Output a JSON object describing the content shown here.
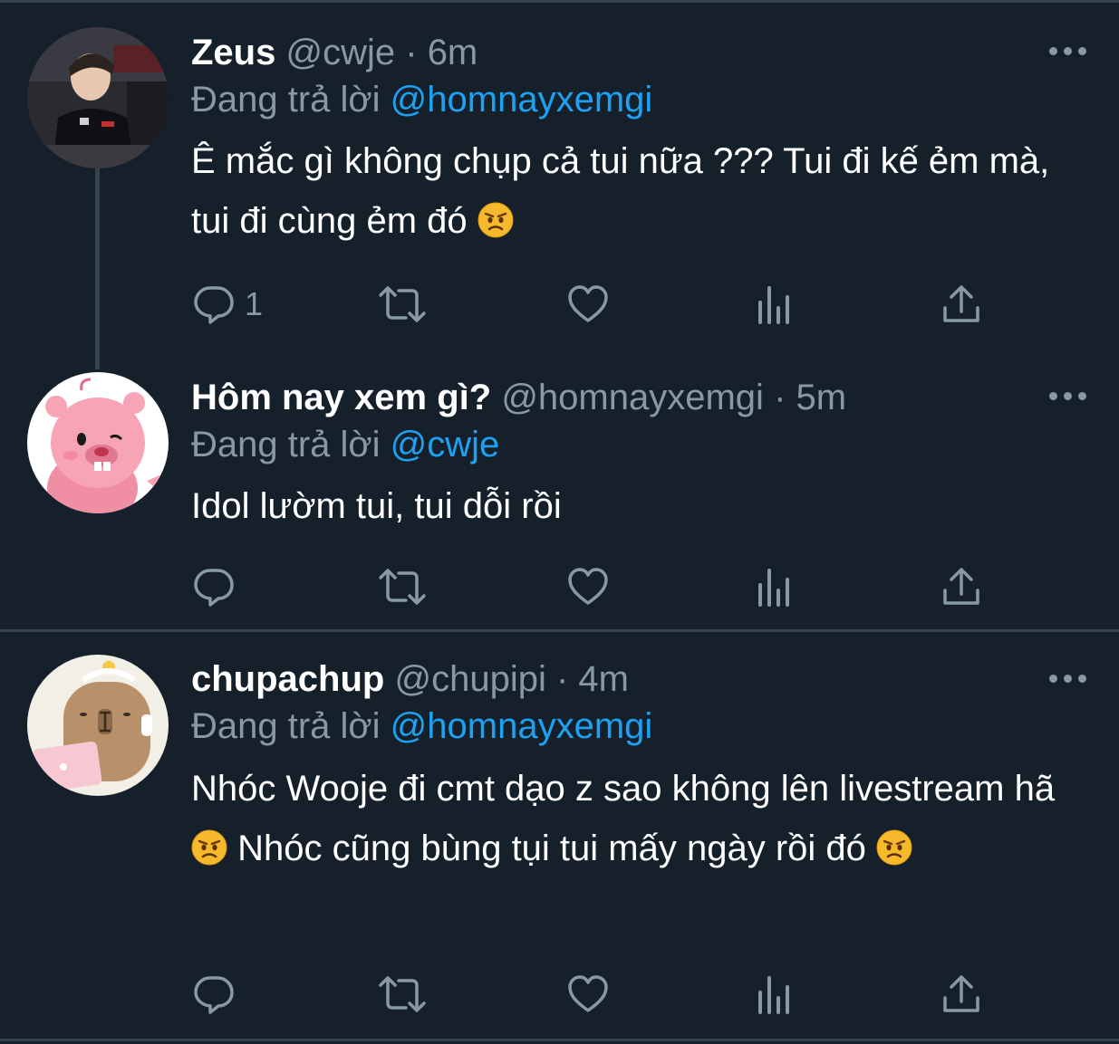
{
  "colors": {
    "background": "#15202b",
    "text_primary": "#ffffff",
    "text_secondary": "#8899a6",
    "accent": "#1da1f2",
    "divider": "#38444d"
  },
  "icons": [
    "reply-icon",
    "retweet-icon",
    "like-icon",
    "analytics-icon",
    "share-icon",
    "more-icon",
    "angry-face-emoji"
  ],
  "tweets": [
    {
      "name": "Zeus",
      "handle": "@cwje",
      "dot": "·",
      "time": "6m",
      "replying_prefix": "Đang trả lời",
      "replying_to": "@homnayxemgi",
      "text_1": "Ê mắc gì không chụp cả tui nữa ??? Tui đi kế ẻm mà, tui đi cùng ẻm đó",
      "reply_count": "1"
    },
    {
      "name": "Hôm nay xem gì?",
      "handle": "@homnayxemgi",
      "dot": "·",
      "time": "5m",
      "replying_prefix": "Đang trả lời",
      "replying_to": "@cwje",
      "text_1": "Idol lườm tui, tui dỗi rồi",
      "reply_count": ""
    },
    {
      "name": "chupachup",
      "handle": "@chupipi",
      "dot": "·",
      "time": "4m",
      "replying_prefix": "Đang trả lời",
      "replying_to": "@homnayxemgi",
      "text_1": "Nhóc Wooje đi cmt dạo z sao không lên livestream hã",
      "text_2": "Nhóc cũng bùng tụi tui mấy ngày rồi đó",
      "reply_count": ""
    }
  ]
}
